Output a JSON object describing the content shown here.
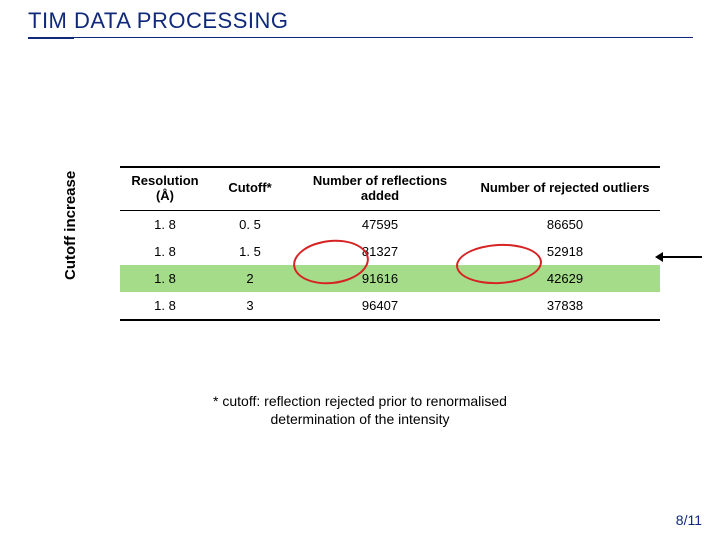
{
  "title": "TIM DATA PROCESSING",
  "vertical_label": "Cutoff increase",
  "chart_data": {
    "type": "table",
    "headers": {
      "resolution": "Resolution (Å)",
      "cutoff": "Cutoff*",
      "added": "Number of reflections added",
      "rejected": "Number of rejected outliers"
    },
    "rows": [
      {
        "resolution": "1. 8",
        "cutoff": "0. 5",
        "added": "47595",
        "rejected": "86650",
        "highlight": false
      },
      {
        "resolution": "1. 8",
        "cutoff": "1. 5",
        "added": "81327",
        "rejected": "52918",
        "highlight": false
      },
      {
        "resolution": "1. 8",
        "cutoff": "2",
        "added": "91616",
        "rejected": "42629",
        "highlight": true
      },
      {
        "resolution": "1. 8",
        "cutoff": "3",
        "added": "96407",
        "rejected": "37838",
        "highlight": false
      }
    ]
  },
  "footnote": "* cutoff: reflection rejected prior to renormalised determination of the intensity",
  "page_number": "8/11"
}
